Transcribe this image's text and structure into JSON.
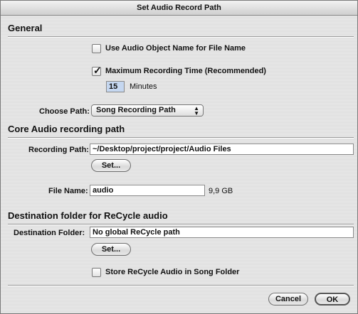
{
  "window": {
    "title": "Set Audio Record Path"
  },
  "general": {
    "heading": "General",
    "use_object_name": {
      "label": "Use Audio Object Name for File Name",
      "checked": false
    },
    "max_recording_time": {
      "label": "Maximum Recording Time (Recommended)",
      "checked": true
    },
    "minutes": {
      "value": "15",
      "unit": "Minutes"
    },
    "choose_path": {
      "label": "Choose Path:",
      "selected": "Song Recording Path"
    }
  },
  "core_audio": {
    "heading": "Core Audio recording path",
    "recording_path_label": "Recording Path:",
    "recording_path_value": "~/Desktop/project/project/Audio Files",
    "set_label": "Set...",
    "file_name_label": "File Name:",
    "file_name_value": "audio",
    "free_space": "9,9 GB"
  },
  "recycle": {
    "heading": "Destination folder for ReCycle audio",
    "destination_label": "Destination Folder:",
    "destination_value": "No global ReCycle path",
    "set_label": "Set...",
    "store_in_song_folder": {
      "label": "Store ReCycle Audio in Song Folder",
      "checked": false
    }
  },
  "footer": {
    "cancel_label": "Cancel",
    "ok_label": "OK"
  }
}
